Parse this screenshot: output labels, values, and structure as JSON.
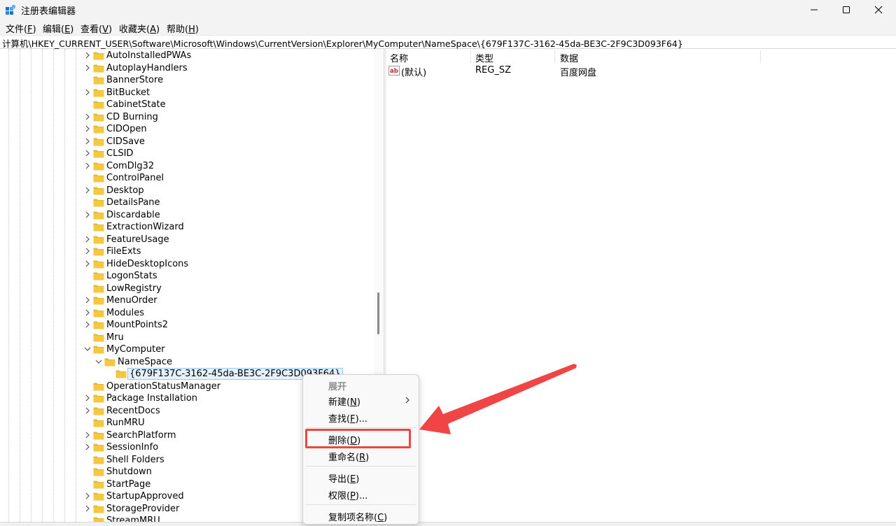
{
  "window": {
    "title": "注册表编辑器",
    "controls": {
      "minimize": "minimize-icon",
      "maximize": "maximize-icon",
      "close": "close-icon"
    }
  },
  "menu": [
    {
      "label": "文件(",
      "key": "F",
      "end": ")"
    },
    {
      "label": "编辑(",
      "key": "E",
      "end": ")"
    },
    {
      "label": "查看(",
      "key": "V",
      "end": ")"
    },
    {
      "label": "收藏夹(",
      "key": "A",
      "end": ")"
    },
    {
      "label": "帮助(",
      "key": "H",
      "end": ")"
    }
  ],
  "address": "计算机\\HKEY_CURRENT_USER\\Software\\Microsoft\\Windows\\CurrentVersion\\Explorer\\MyComputer\\NameSpace\\{679F137C-3162-45da-BE3C-2F9C3D093F64}",
  "tree": {
    "nodes": [
      {
        "label": "AutoInstalledPWAs",
        "level": 0,
        "expander": "collapsed"
      },
      {
        "label": "AutoplayHandlers",
        "level": 0,
        "expander": "collapsed"
      },
      {
        "label": "BannerStore",
        "level": 0,
        "expander": "none"
      },
      {
        "label": "BitBucket",
        "level": 0,
        "expander": "collapsed"
      },
      {
        "label": "CabinetState",
        "level": 0,
        "expander": "none"
      },
      {
        "label": "CD Burning",
        "level": 0,
        "expander": "collapsed"
      },
      {
        "label": "CIDOpen",
        "level": 0,
        "expander": "collapsed"
      },
      {
        "label": "CIDSave",
        "level": 0,
        "expander": "collapsed"
      },
      {
        "label": "CLSID",
        "level": 0,
        "expander": "collapsed"
      },
      {
        "label": "ComDlg32",
        "level": 0,
        "expander": "collapsed"
      },
      {
        "label": "ControlPanel",
        "level": 0,
        "expander": "none"
      },
      {
        "label": "Desktop",
        "level": 0,
        "expander": "collapsed"
      },
      {
        "label": "DetailsPane",
        "level": 0,
        "expander": "none"
      },
      {
        "label": "Discardable",
        "level": 0,
        "expander": "collapsed"
      },
      {
        "label": "ExtractionWizard",
        "level": 0,
        "expander": "none"
      },
      {
        "label": "FeatureUsage",
        "level": 0,
        "expander": "collapsed"
      },
      {
        "label": "FileExts",
        "level": 0,
        "expander": "collapsed"
      },
      {
        "label": "HideDesktopIcons",
        "level": 0,
        "expander": "collapsed"
      },
      {
        "label": "LogonStats",
        "level": 0,
        "expander": "none"
      },
      {
        "label": "LowRegistry",
        "level": 0,
        "expander": "none"
      },
      {
        "label": "MenuOrder",
        "level": 0,
        "expander": "collapsed"
      },
      {
        "label": "Modules",
        "level": 0,
        "expander": "collapsed"
      },
      {
        "label": "MountPoints2",
        "level": 0,
        "expander": "collapsed"
      },
      {
        "label": "Mru",
        "level": 0,
        "expander": "none"
      },
      {
        "label": "MyComputer",
        "level": 0,
        "expander": "expanded"
      },
      {
        "label": "NameSpace",
        "level": 1,
        "expander": "expanded"
      },
      {
        "label": "{679F137C-3162-45da-BE3C-2F9C3D093F64}",
        "level": 2,
        "expander": "none",
        "selected": true
      },
      {
        "label": "OperationStatusManager",
        "level": 0,
        "expander": "none"
      },
      {
        "label": "Package Installation",
        "level": 0,
        "expander": "collapsed"
      },
      {
        "label": "RecentDocs",
        "level": 0,
        "expander": "collapsed"
      },
      {
        "label": "RunMRU",
        "level": 0,
        "expander": "none"
      },
      {
        "label": "SearchPlatform",
        "level": 0,
        "expander": "collapsed"
      },
      {
        "label": "SessionInfo",
        "level": 0,
        "expander": "collapsed"
      },
      {
        "label": "Shell Folders",
        "level": 0,
        "expander": "none"
      },
      {
        "label": "Shutdown",
        "level": 0,
        "expander": "none"
      },
      {
        "label": "StartPage",
        "level": 0,
        "expander": "none"
      },
      {
        "label": "StartupApproved",
        "level": 0,
        "expander": "collapsed"
      },
      {
        "label": "StorageProvider",
        "level": 0,
        "expander": "collapsed"
      },
      {
        "label": "StreamMRU",
        "level": 0,
        "expander": "none"
      }
    ]
  },
  "values_pane": {
    "columns": [
      "名称",
      "类型",
      "数据"
    ],
    "rows": [
      {
        "name": "(默认)",
        "type": "REG_SZ",
        "data": "百度网盘",
        "icon": "string-value-icon"
      }
    ]
  },
  "context_menu": {
    "items": [
      {
        "kind": "header",
        "label": "展开"
      },
      {
        "kind": "item",
        "label": "新建(",
        "key": "N",
        "end": ")",
        "submenu": true
      },
      {
        "kind": "item",
        "label": "查找(",
        "key": "F",
        "end": ")..."
      },
      {
        "kind": "sep"
      },
      {
        "kind": "item",
        "label": "删除(",
        "key": "D",
        "end": ")",
        "highlighted": true
      },
      {
        "kind": "item",
        "label": "重命名(",
        "key": "R",
        "end": ")"
      },
      {
        "kind": "sep"
      },
      {
        "kind": "item",
        "label": "导出(",
        "key": "E",
        "end": ")"
      },
      {
        "kind": "item",
        "label": "权限(",
        "key": "P",
        "end": ")..."
      },
      {
        "kind": "sep"
      },
      {
        "kind": "item",
        "label": "复制项名称(",
        "key": "C",
        "end": ")"
      }
    ]
  },
  "colors": {
    "annotation_red": "#ef4545",
    "folder_yellow": "#f5c842",
    "selection_border": "#99c9ef",
    "selection_fill": "#e5f1fb"
  }
}
